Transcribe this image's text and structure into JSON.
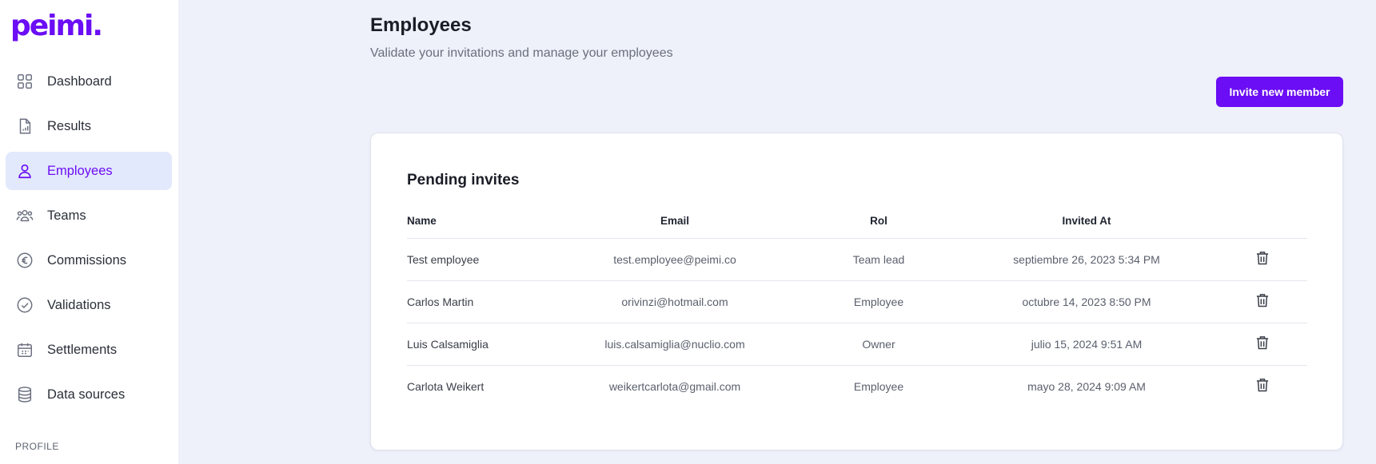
{
  "brand": {
    "logo_text": "peimi.",
    "accent": "#6b0df5"
  },
  "sidebar": {
    "items": [
      {
        "label": "Dashboard",
        "icon": "grid-icon",
        "active": false
      },
      {
        "label": "Results",
        "icon": "document-chart-icon",
        "active": false
      },
      {
        "label": "Employees",
        "icon": "user-icon",
        "active": true
      },
      {
        "label": "Teams",
        "icon": "users-group-icon",
        "active": false
      },
      {
        "label": "Commissions",
        "icon": "euro-icon",
        "active": false
      },
      {
        "label": "Validations",
        "icon": "check-circle-icon",
        "active": false
      },
      {
        "label": "Settlements",
        "icon": "calendar-icon",
        "active": false
      },
      {
        "label": "Data sources",
        "icon": "database-icon",
        "active": false
      }
    ],
    "section_label": "PROFILE"
  },
  "page": {
    "title": "Employees",
    "subtitle": "Validate your invitations and manage your employees",
    "invite_button": "Invite new member"
  },
  "pending": {
    "title": "Pending invites",
    "columns": [
      "Name",
      "Email",
      "Rol",
      "Invited At"
    ],
    "rows": [
      {
        "name": "Test employee",
        "email": "test.employee@peimi.co",
        "rol": "Team lead",
        "invited_at": "septiembre 26, 2023 5:34 PM"
      },
      {
        "name": "Carlos Martin",
        "email": "orivinzi@hotmail.com",
        "rol": "Employee",
        "invited_at": "octubre 14, 2023 8:50 PM"
      },
      {
        "name": "Luis Calsamiglia",
        "email": "luis.calsamiglia@nuclio.com",
        "rol": "Owner",
        "invited_at": "julio 15, 2024 9:51 AM"
      },
      {
        "name": "Carlota Weikert",
        "email": "weikertcarlota@gmail.com",
        "rol": "Employee",
        "invited_at": "mayo 28, 2024 9:09 AM"
      }
    ]
  }
}
